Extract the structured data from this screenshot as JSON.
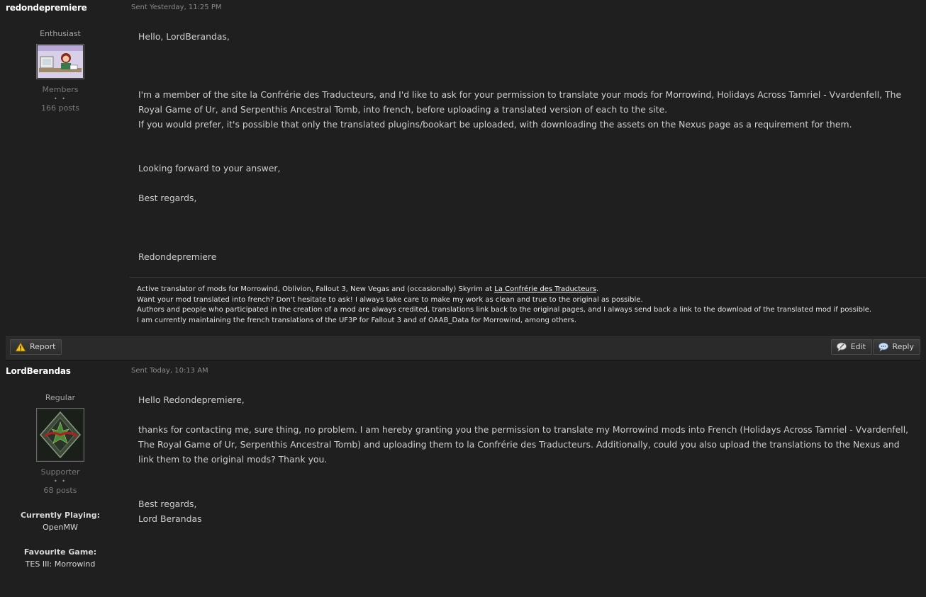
{
  "posts": [
    {
      "author": "redondepremiere",
      "sent": "Sent Yesterday, 11:25 PM",
      "title": "Enthusiast",
      "group": "Members",
      "pips": "• •",
      "post_count": "166 posts",
      "body": [
        "Hello, LordBerandas,",
        "I'm a member of the site la Confrérie des Traducteurs, and I'd like to ask for your permission to translate your mods for Morrowind, Holidays Across Tamriel - Vvardenfell, The Royal Game of Ur, and Serpenthis Ancestral Tomb, into french, before uploading a translated version of each to the site.",
        "If you would prefer, it's possible that only the translated plugins/bookart be uploaded, with downloading the assets on the Nexus page as a requirement for them.",
        "Looking forward to your answer,",
        "Best regards,",
        "Redondepremiere"
      ],
      "signature": {
        "line1_prefix": "Active translator of mods for Morrowind, Oblivion, Fallout 3, New Vegas and (occasionally) Skyrim  at ",
        "line1_link": "La Confrérie des Traducteurs",
        "line1_suffix": ".",
        "line2": "Want your mod translated into french? Don't hesitate to ask! I always take care to make my work as clean and true to the original as possible.",
        "line3": "Authors and people who participated in the creation of a mod are always credited, translations link back to the original pages, and I always send back a link to the download of the translated mod if possible.",
        "line4": "I am currently maintaining the french translations of the UF3P for Fallout 3 and of OAAB_Data for Morrowind, among others."
      }
    },
    {
      "author": "LordBerandas",
      "sent": "Sent Today, 10:13 AM",
      "title": "Regular",
      "group": "Supporter",
      "pips": "• •",
      "post_count": "68 posts",
      "body": [
        "Hello Redondepremiere,",
        "thanks for contacting me, sure thing, no problem. I am hereby granting you the permission to translate my Morrowind mods into French (Holidays Across Tamriel - Vvardenfell, The Royal Game of Ur, Serpenthis Ancestral Tomb) and uploading them to la Confrérie des Traducteurs. Additionally, could you also upload the translations to the Nexus and link them to the original mods? Thank you.",
        "Best regards,",
        "Lord Berandas"
      ],
      "currently_playing_label": "Currently Playing:",
      "currently_playing_value": "OpenMW",
      "favourite_game_label": "Favourite Game:",
      "favourite_game_value": "TES III: Morrowind"
    }
  ],
  "actions": {
    "report": "Report",
    "edit": "Edit",
    "reply": "Reply"
  },
  "colors": {
    "background": "#1f1f1f",
    "action_bar": "#2a2a2a"
  }
}
